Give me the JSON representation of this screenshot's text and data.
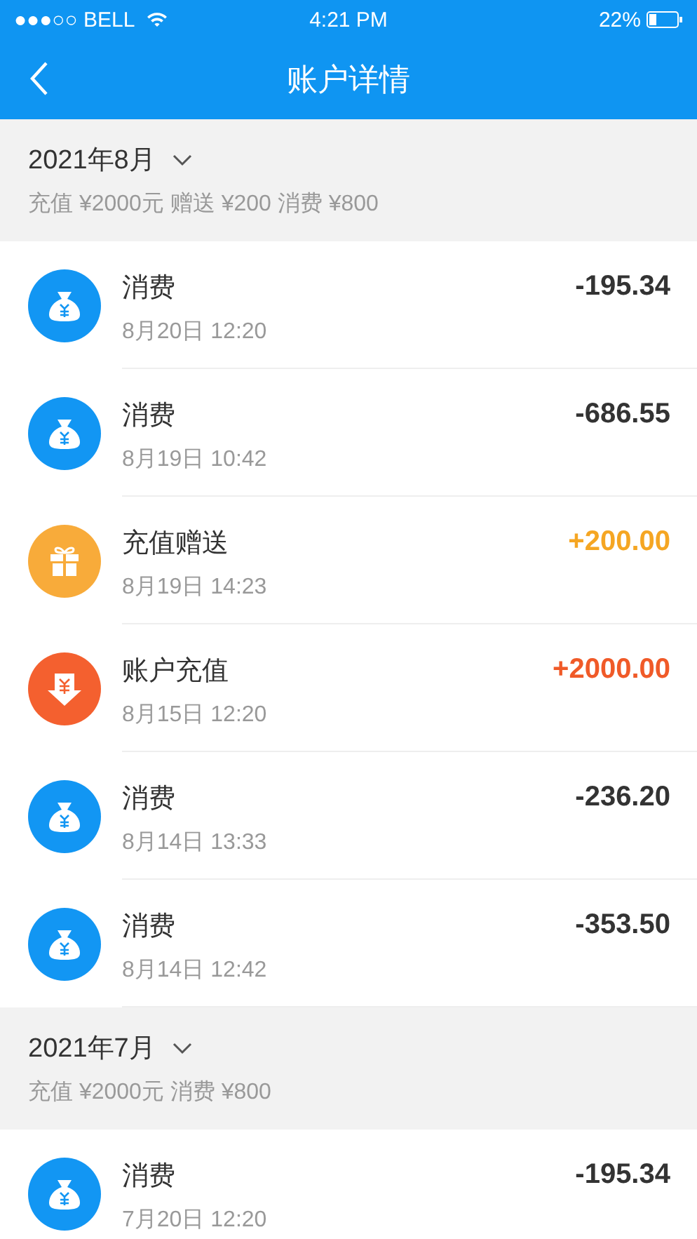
{
  "status_bar": {
    "carrier": "●●●○○ BELL",
    "time": "4:21 PM",
    "battery": "22%"
  },
  "nav": {
    "title": "账户详情"
  },
  "months": [
    {
      "title": "2021年8月",
      "summary": "充值 ¥2000元 赠送 ¥200 消费 ¥800",
      "expanded": true,
      "records": [
        {
          "kind": "spend",
          "name": "消费",
          "time": "8月20日 12:20",
          "amount": "-195.34"
        },
        {
          "kind": "spend",
          "name": "消费",
          "time": "8月19日 10:42",
          "amount": "-686.55"
        },
        {
          "kind": "gift",
          "name": "充值赠送",
          "time": "8月19日 14:23",
          "amount": "+200.00"
        },
        {
          "kind": "recharge",
          "name": "账户充值",
          "time": "8月15日 12:20",
          "amount": "+2000.00"
        },
        {
          "kind": "spend",
          "name": "消费",
          "time": "8月14日 13:33",
          "amount": "-236.20"
        },
        {
          "kind": "spend",
          "name": "消费",
          "time": "8月14日 12:42",
          "amount": "-353.50"
        }
      ]
    },
    {
      "title": "2021年7月",
      "summary": "充值 ¥2000元 消费 ¥800",
      "expanded": true,
      "records": [
        {
          "kind": "spend",
          "name": "消费",
          "time": "7月20日 12:20",
          "amount": "-195.34"
        }
      ]
    }
  ]
}
